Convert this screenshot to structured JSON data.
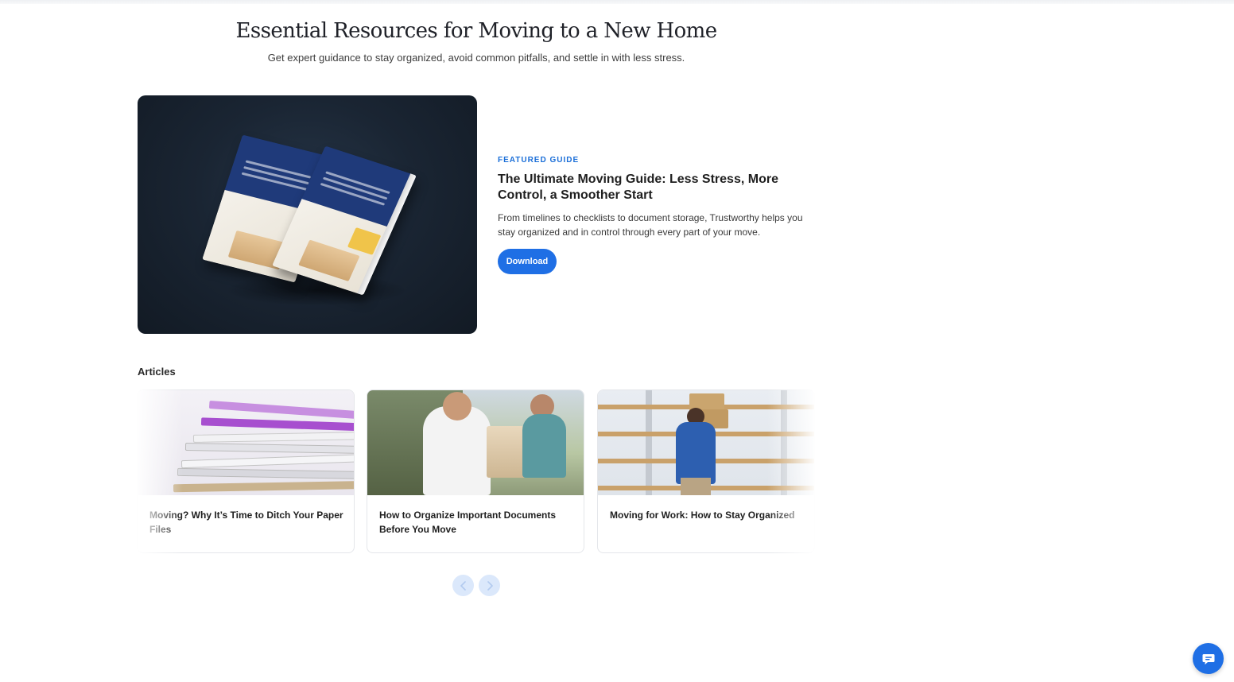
{
  "hero": {
    "title": "Essential Resources for Moving to a New Home",
    "subtitle": "Get expert guidance to stay organized, avoid common pitfalls, and settle in with less stress."
  },
  "featured": {
    "kicker": "FEATURED GUIDE",
    "title": "The Ultimate Moving Guide: Less Stress, More Control, a Smoother Start",
    "description": "From timelines to checklists to document storage, Trustworthy helps you stay organized and in control through every part of your move.",
    "download_label": "Download",
    "image_alt": "The Ultimate Moving Guide book covers"
  },
  "articles": {
    "heading": "Articles",
    "items": [
      {
        "title": "Moving? Why It’s Time to Ditch Your Paper Files"
      },
      {
        "title": "How to Organize Important Documents Before You Move"
      },
      {
        "title": "Moving for Work: How to Stay Organized"
      }
    ]
  },
  "carousel": {
    "prev_icon": "chevron-left-icon",
    "next_icon": "chevron-right-icon"
  },
  "chat": {
    "icon": "chat-bubble-icon"
  },
  "colors": {
    "accent": "#1f6fe5",
    "kicker": "#1a6ed8",
    "featured_bg": "#1a2533"
  }
}
